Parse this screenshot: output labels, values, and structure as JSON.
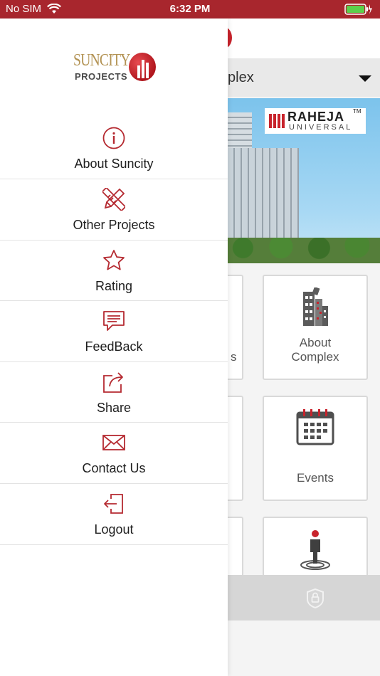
{
  "status_bar": {
    "carrier": "No SIM",
    "time": "6:32 PM"
  },
  "background": {
    "selector_text": "plex",
    "banner": {
      "logo_title": "RAHEJA",
      "logo_subtitle": "UNIVERSAL",
      "logo_tm": "TM"
    },
    "tiles": {
      "left_fragment": "s",
      "about_complex": "About\nComplex",
      "events": "Events"
    }
  },
  "drawer": {
    "brand": {
      "name": "SUNCITY",
      "sub": "PROJECTS"
    },
    "menu": [
      {
        "label": "About Suncity",
        "icon": "info-icon"
      },
      {
        "label": "Other Projects",
        "icon": "pencil-ruler-icon"
      },
      {
        "label": "Rating",
        "icon": "star-icon"
      },
      {
        "label": "FeedBack",
        "icon": "chat-bubble-icon"
      },
      {
        "label": "Share",
        "icon": "share-icon"
      },
      {
        "label": "Contact Us",
        "icon": "envelope-icon"
      },
      {
        "label": "Logout",
        "icon": "logout-icon"
      }
    ]
  },
  "colors": {
    "status_bar": "#a8262d",
    "accent_red": "#c8232c",
    "menu_icon": "#b52a31"
  }
}
